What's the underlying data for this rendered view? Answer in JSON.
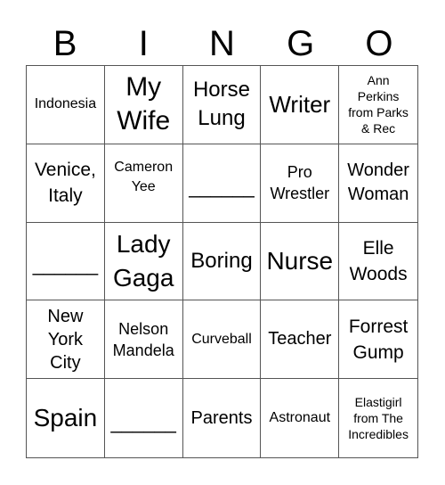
{
  "header": [
    "B",
    "I",
    "N",
    "G",
    "O"
  ],
  "cells": [
    [
      "Indonesia",
      "My\nWife",
      "Horse\nLung",
      "Writer",
      "Ann\nPerkins\nfrom Parks\n& Rec"
    ],
    [
      "Venice,\nItaly",
      "Cameron\nYee",
      "______",
      "Pro\nWrestler",
      "Wonder\nWoman"
    ],
    [
      "______",
      "Lady\nGaga",
      "Boring",
      "Nurse",
      "Elle\nWoods"
    ],
    [
      "New\nYork\nCity",
      "Nelson\nMandela",
      "Curveball",
      "Teacher",
      "Forrest\nGump"
    ],
    [
      "Spain",
      "______",
      "Parents",
      "Astronaut",
      "Elastigirl\nfrom The\nIncredibles"
    ]
  ]
}
